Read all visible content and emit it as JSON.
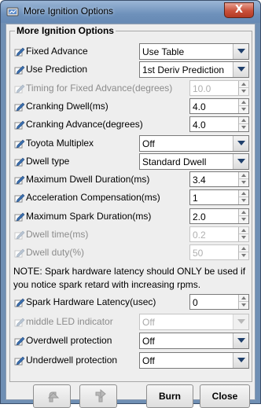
{
  "window": {
    "title": "More Ignition Options",
    "close_glyph": "X"
  },
  "group": {
    "title": "More Ignition Options"
  },
  "rows": [
    {
      "label": "Fixed Advance",
      "control": "combo",
      "value": "Use Table",
      "enabled": true
    },
    {
      "label": "Use Prediction",
      "control": "combo",
      "value": "1st Deriv Prediction",
      "enabled": true
    },
    {
      "label": "Timing for Fixed Advance(degrees)",
      "control": "spinner",
      "value": "10.0",
      "enabled": false
    },
    {
      "label": "Cranking Dwell(ms)",
      "control": "spinner",
      "value": "4.0",
      "enabled": true
    },
    {
      "label": "Cranking Advance(degrees)",
      "control": "spinner",
      "value": "4.0",
      "enabled": true
    },
    {
      "label": "Toyota Multiplex",
      "control": "combo",
      "value": "Off",
      "enabled": true
    },
    {
      "label": "Dwell type",
      "control": "combo",
      "value": "Standard Dwell",
      "enabled": true
    },
    {
      "label": "Maximum Dwell Duration(ms)",
      "control": "spinner",
      "value": "3.4",
      "enabled": true
    },
    {
      "label": "Acceleration Compensation(ms)",
      "control": "spinner",
      "value": "1",
      "enabled": true
    },
    {
      "label": "Maximum Spark Duration(ms)",
      "control": "spinner",
      "value": "2.0",
      "enabled": true
    },
    {
      "label": "Dwell time(ms)",
      "control": "spinner",
      "value": "0.2",
      "enabled": false
    },
    {
      "label": "Dwell duty(%)",
      "control": "spinner",
      "value": "50",
      "enabled": false
    }
  ],
  "note": "NOTE: Spark hardware latency should ONLY be used if you notice spark retard with increasing rpms.",
  "rows2": [
    {
      "label": "Spark Hardware Latency(usec)",
      "control": "spinner",
      "value": "0",
      "enabled": true
    },
    {
      "label": "middle LED indicator",
      "control": "combo",
      "value": "Off",
      "enabled": false
    },
    {
      "label": "Overdwell protection",
      "control": "combo",
      "value": "Off",
      "enabled": true
    },
    {
      "label": "Underdwell protection",
      "control": "combo",
      "value": "Off",
      "enabled": true
    }
  ],
  "buttons": {
    "burn_label": "Burn",
    "close_label": "Close"
  },
  "icons": {
    "title": "gear-app-icon",
    "row": "edit-pencil-icon",
    "undo": "undo-arrow-icon",
    "redo": "redo-arrow-icon"
  },
  "colors": {
    "title_bar": "#6e91bb",
    "close_button": "#c9503a",
    "panel_bg": "#eeeeee",
    "disabled_text": "#8c8c8c"
  }
}
